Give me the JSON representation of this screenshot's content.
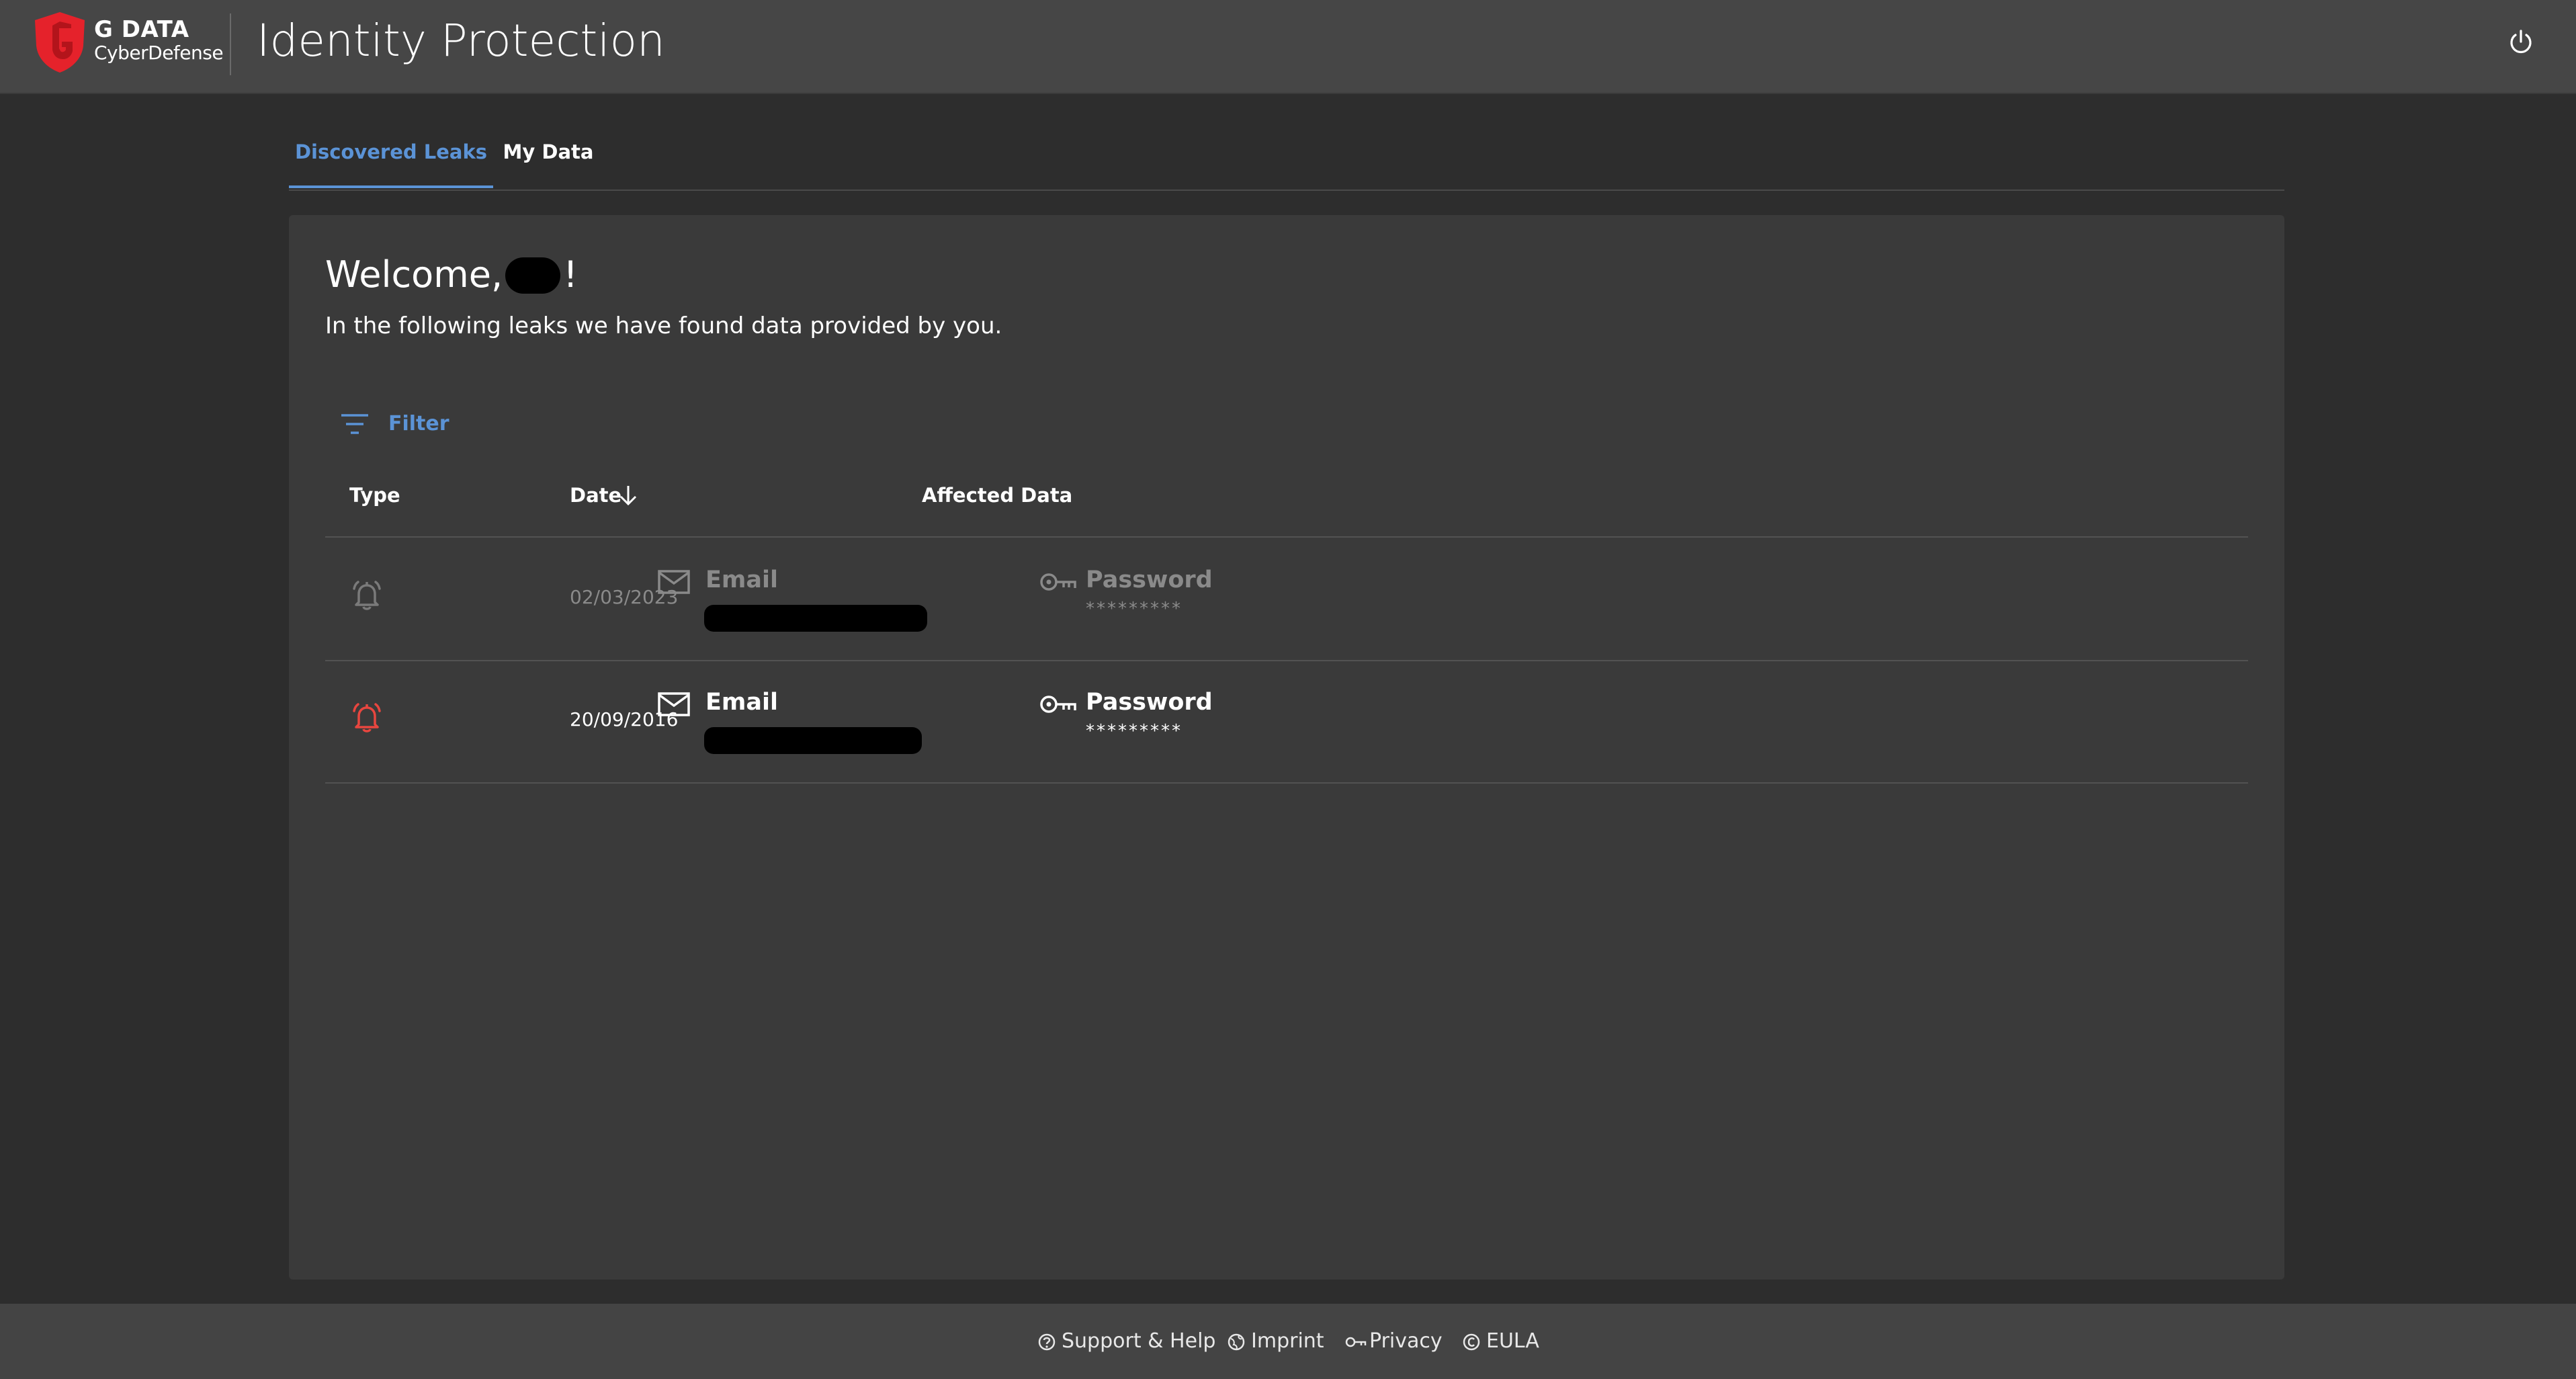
{
  "header": {
    "brand_line1": "G DATA",
    "brand_line2": "CyberDefense",
    "app_title": "Identity Protection",
    "logo_icon": "gdata-shield-logo",
    "power_icon": "power-icon"
  },
  "tabs": [
    {
      "label": "Discovered Leaks",
      "active": true
    },
    {
      "label": "My Data",
      "active": false
    }
  ],
  "main": {
    "welcome_prefix": "Welcome,",
    "welcome_suffix": "!",
    "subtitle": "In the following leaks we have found data provided by you.",
    "filter_label": "Filter"
  },
  "table": {
    "headers": {
      "type": "Type",
      "date": "Date",
      "affected": "Affected Data"
    },
    "rows": [
      {
        "date": "02/03/2023",
        "email_label": "Email",
        "password_label": "Password",
        "password_mask": "*********",
        "status": "read",
        "bell_color": "#7a7a7a"
      },
      {
        "date": "20/09/2016",
        "email_label": "Email",
        "password_label": "Password",
        "password_mask": "*********",
        "status": "new",
        "bell_color": "#e8463f"
      }
    ]
  },
  "footer": {
    "links": [
      "Support & Help",
      "Imprint",
      "Privacy",
      "EULA"
    ]
  },
  "colors": {
    "accent": "#5b93d6",
    "alert": "#e8463f",
    "brand_red": "#e5222b",
    "background": "#2d2d2d",
    "card": "#3a3a3a",
    "header": "#464646"
  }
}
